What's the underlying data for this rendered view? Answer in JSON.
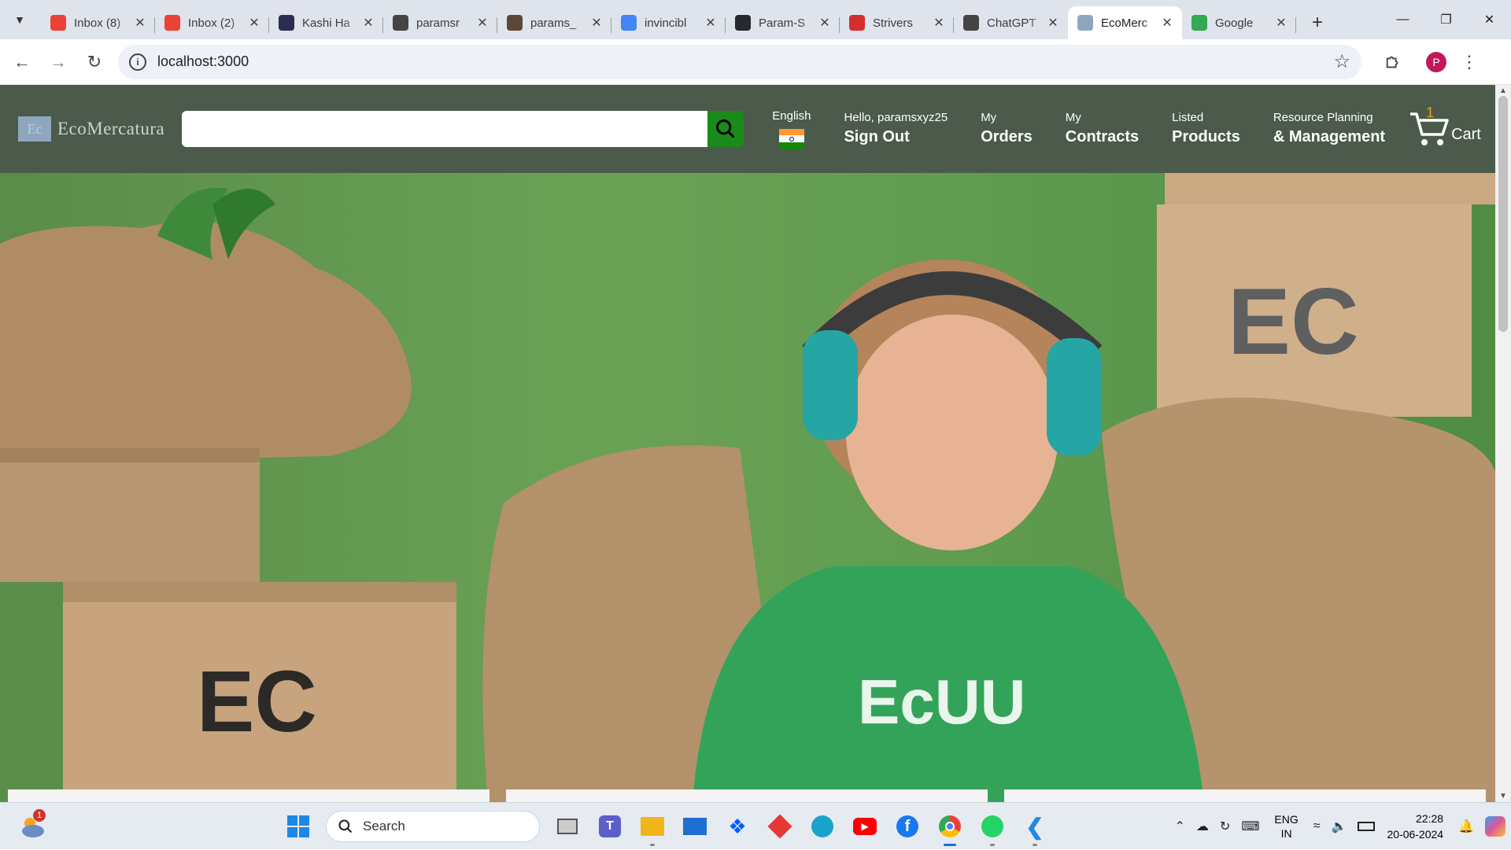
{
  "browser": {
    "tabs": [
      {
        "title": "Inbox (8)",
        "favicon": "gmail-icon",
        "color": "#ea4335"
      },
      {
        "title": "Inbox (2)",
        "favicon": "gmail-icon",
        "color": "#ea4335"
      },
      {
        "title": "Kashi Ha",
        "favicon": "hashnode-icon",
        "color": "#2c2c54"
      },
      {
        "title": "paramsr",
        "favicon": "leetcode-icon",
        "color": "#444444"
      },
      {
        "title": "params_",
        "favicon": "codechef-icon",
        "color": "#5b4638"
      },
      {
        "title": "invincibl",
        "favicon": "analytics-icon",
        "color": "#4285f4"
      },
      {
        "title": "Param-S",
        "favicon": "github-icon",
        "color": "#24292e"
      },
      {
        "title": "Strivers",
        "favicon": "tuf-icon",
        "color": "#d32f2f"
      },
      {
        "title": "ChatGPT",
        "favicon": "chatgpt-icon",
        "color": "#444444"
      },
      {
        "title": "EcoMerc",
        "favicon": "ecomercatura-icon",
        "color": "#8fa6bf",
        "active": true
      },
      {
        "title": "Google",
        "favicon": "google-icon",
        "color": "#34a853"
      }
    ],
    "url": "localhost:3000",
    "profile_initial": "P"
  },
  "site": {
    "brand_logo_text": "Ec",
    "brand_name": "EcoMercatura",
    "search_placeholder": "",
    "language": "English",
    "greeting": "Hello, paramsxyz25",
    "sign_out": "Sign Out",
    "nav": [
      {
        "small": "My",
        "big": "Orders"
      },
      {
        "small": "My",
        "big": "Contracts"
      },
      {
        "small": "Listed",
        "big": "Products"
      },
      {
        "small": "Resource Planning",
        "big": "& Management"
      }
    ],
    "cart_count": "1",
    "cart_label": "Cart",
    "header_bg": "#4b5a4b",
    "search_btn_color": "#1a8a1a",
    "hero_box_text": "EC",
    "hero_shirt_text": "EcUU"
  },
  "taskbar": {
    "search_label": "Search",
    "weather_badge": "1",
    "lang_top": "ENG",
    "lang_bottom": "IN",
    "time": "22:28",
    "date": "20-06-2024"
  }
}
